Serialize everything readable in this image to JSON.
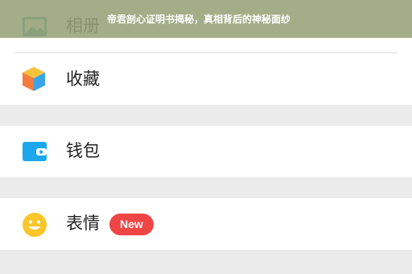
{
  "overlay": {
    "headline": "帝君剖心证明书揭秘，真相背后的神秘面纱"
  },
  "menu": {
    "items": [
      {
        "label": "相册",
        "icon": "album-icon"
      },
      {
        "label": "收藏",
        "icon": "cube-favorites-icon"
      },
      {
        "label": "钱包",
        "icon": "wallet-icon"
      },
      {
        "label": "表情",
        "icon": "smiley-icon",
        "badge": "New"
      }
    ]
  },
  "colors": {
    "background": "#ebebeb",
    "row": "#ffffff",
    "badge": "#f04545",
    "wallet_icon": "#1aa7ee",
    "smiley_icon": "#fbc62a",
    "album_icon": "#3a9ba6",
    "overlay": "#96a278"
  }
}
